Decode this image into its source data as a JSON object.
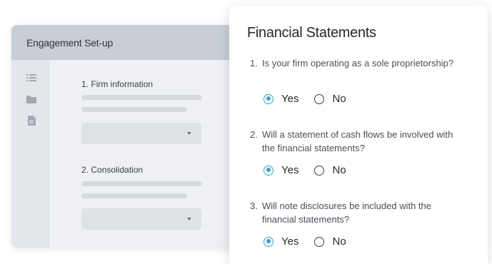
{
  "setup_panel": {
    "title": "Engagement Set-up",
    "sections": [
      {
        "number": "1.",
        "label": "Firm information"
      },
      {
        "number": "2.",
        "label": "Consolidation"
      }
    ],
    "rail_icons": [
      "list-icon",
      "folder-icon",
      "document-icon"
    ]
  },
  "card": {
    "title": "Financial Statements",
    "questions": [
      {
        "number": "1.",
        "text": "Is your firm operating as a sole proprietorship?",
        "options": [
          "Yes",
          "No"
        ],
        "selected": "Yes"
      },
      {
        "number": "2.",
        "text": "Will a statement of cash flows be involved with the financial statements?",
        "options": [
          "Yes",
          "No"
        ],
        "selected": "Yes"
      },
      {
        "number": "3.",
        "text": "Will note disclosures be included with the financial statements?",
        "options": [
          "Yes",
          "No"
        ],
        "selected": "Yes"
      }
    ]
  },
  "colors": {
    "accent": "#2ea3d8",
    "panel_header": "#c9ced6",
    "panel_bg": "#eef0f3"
  }
}
